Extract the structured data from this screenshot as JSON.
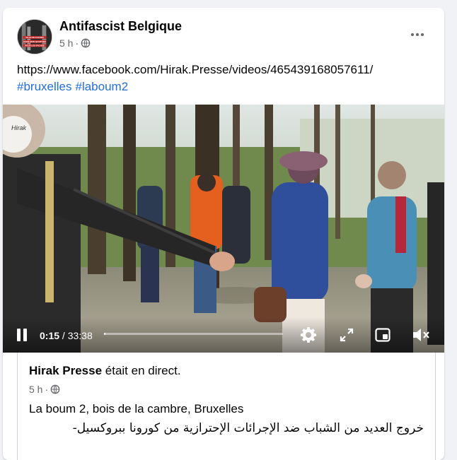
{
  "post": {
    "page_name": "Antifascist Belgique",
    "time_ago": "5 h",
    "separator": "·",
    "link": "https://www.facebook.com/Hirak.Presse/videos/465439168057611/",
    "hashtags": [
      "#bruxelles",
      "#laboum2"
    ]
  },
  "avatar": {
    "text_lines": [
      "VILLE DE FACHES",
      "DANS MON QUARTIER",
      "POUR LES FACHOS"
    ]
  },
  "video": {
    "current_time": "0:15",
    "separator": " / ",
    "duration": "33:38",
    "progress_fraction": 0.007,
    "watermark": "Hirak"
  },
  "shared": {
    "author": "Hirak Presse",
    "action": "était en direct.",
    "time_ago": "5 h",
    "separator": "·",
    "caption": "La boum 2, bois de la cambre, Bruxelles",
    "arabic_text": "خروج العديد من الشباب ضد الإجرائات الإحترازية من كورونا ببروكسيل- "
  },
  "icons": {
    "more": "more-horizontal-icon",
    "globe": "globe-icon",
    "pause": "pause-icon",
    "settings": "settings-gear-icon",
    "fullscreen": "fullscreen-icon",
    "pip": "picture-in-picture-icon",
    "mute": "volume-muted-icon"
  }
}
